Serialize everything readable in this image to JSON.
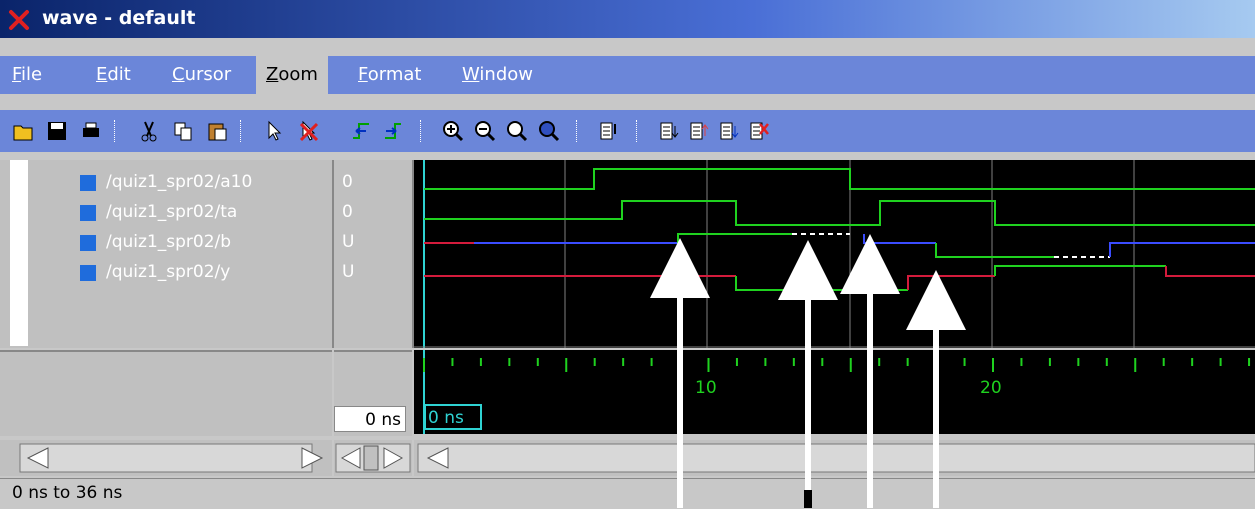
{
  "window": {
    "title": "wave - default"
  },
  "menu": [
    {
      "mnemonic": "F",
      "rest": "ile"
    },
    {
      "mnemonic": "E",
      "rest": "dit"
    },
    {
      "mnemonic": "C",
      "rest": "ursor"
    },
    {
      "mnemonic": "Z",
      "rest": "oom"
    },
    {
      "mnemonic": "F",
      "rest": "ormat",
      "pre": ""
    },
    {
      "mnemonic": "W",
      "rest": "indow"
    }
  ],
  "signals": [
    {
      "name": "/quiz1_spr02/a10",
      "value": "0"
    },
    {
      "name": "/quiz1_spr02/ta",
      "value": "0"
    },
    {
      "name": "/quiz1_spr02/b",
      "value": "U"
    },
    {
      "name": "/quiz1_spr02/y",
      "value": "U"
    }
  ],
  "timeline": {
    "labels": [
      "10",
      "20"
    ]
  },
  "cursor": {
    "now_value": "0 ns",
    "cursor_value": "0 ns"
  },
  "status": {
    "range": "0 ns to 36 ns"
  },
  "colors": {
    "wave_high": "#1fd21f",
    "wave_red": "#d41b3c",
    "wave_blue": "#3b4cff",
    "menubar": "#6b86d9"
  }
}
